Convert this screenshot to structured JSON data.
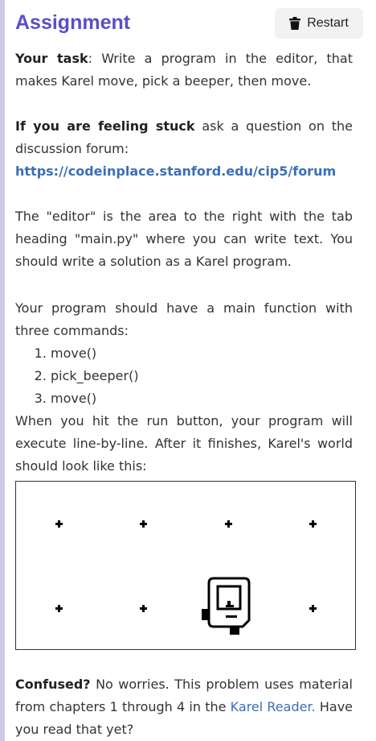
{
  "header": {
    "title": "Assignment",
    "restart_label": "Restart"
  },
  "task": {
    "label": "Your task",
    "text": ": Write a program in the editor, that makes Karel move, pick a beeper, then move."
  },
  "stuck": {
    "label": "If you are feeling stuck",
    "text": " ask a question on the discussion forum:",
    "link": "https://codeinplace.stanford.edu/cip5/forum"
  },
  "editor_note": "The \"editor\" is the area to the right with the tab heading \"main.py\" where you can write text. You should write a solution as a Karel program.",
  "program_intro": "Your program should have a main function with three commands:",
  "commands": [
    "move()",
    "pick_beeper()",
    "move()"
  ],
  "run_note": "When you hit the run button, your program will execute line-by-line. After it finishes, Karel's world should look like this:",
  "world": {
    "columns": 4,
    "rows": 2,
    "karel_column": 3,
    "karel_row": 1
  },
  "confused": {
    "label": "Confused?",
    "text_before": " No worries. This problem uses material from chapters 1 through 4 in the ",
    "link": "Karel Reader.",
    "text_after": " Have you read that yet?"
  }
}
